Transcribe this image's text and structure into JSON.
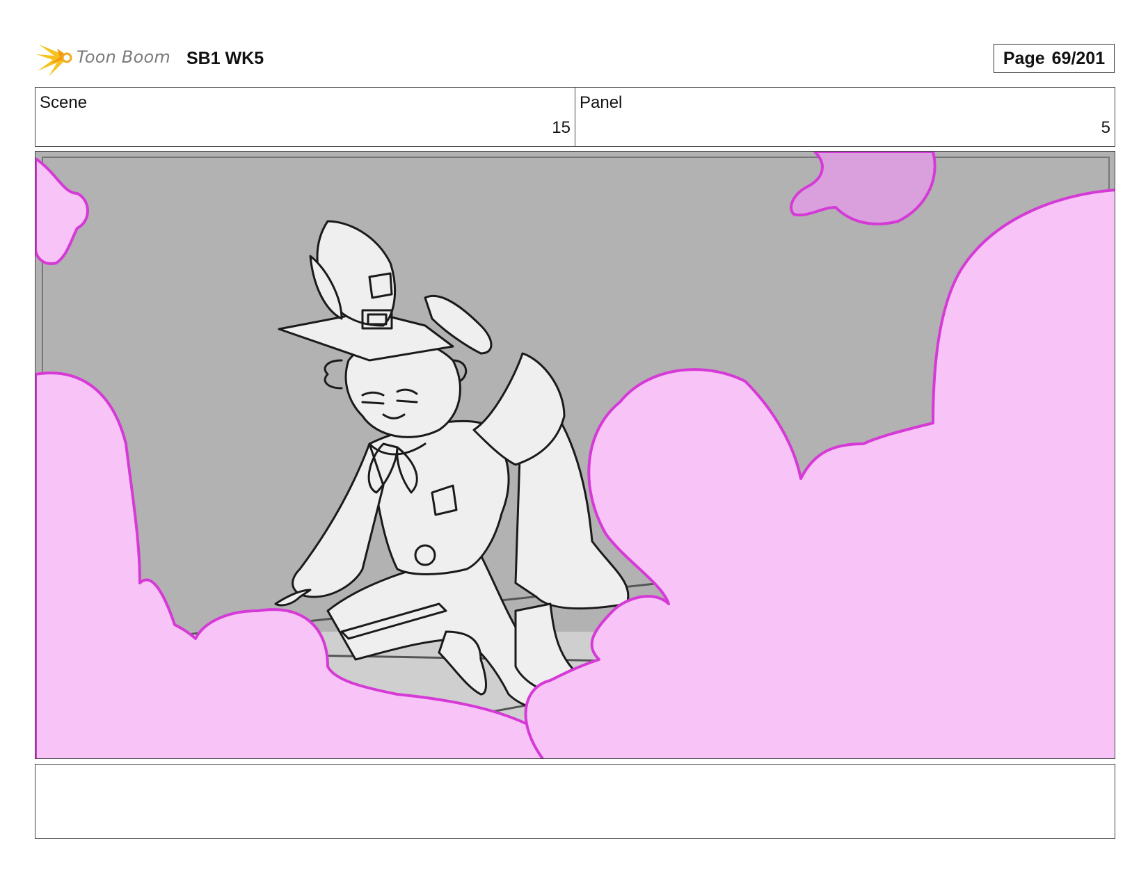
{
  "header": {
    "logo_text": "Toon Boom",
    "project_title": "SB1 WK5",
    "page_label": "Page",
    "page_value": "69/201"
  },
  "info": {
    "scene_label": "Scene",
    "scene_value": "15",
    "panel_label": "Panel",
    "panel_value": "5"
  },
  "panel": {
    "icon": "storyboard-drawing",
    "colors": {
      "background": "#b2b2b2",
      "floor": "#cfcfcf",
      "smoke_fill": "#f8c4f8",
      "smoke_stroke": "#d63ad6",
      "line": "#1a1a1a",
      "character_fill": "#efefef"
    }
  },
  "notes": {
    "text": ""
  }
}
